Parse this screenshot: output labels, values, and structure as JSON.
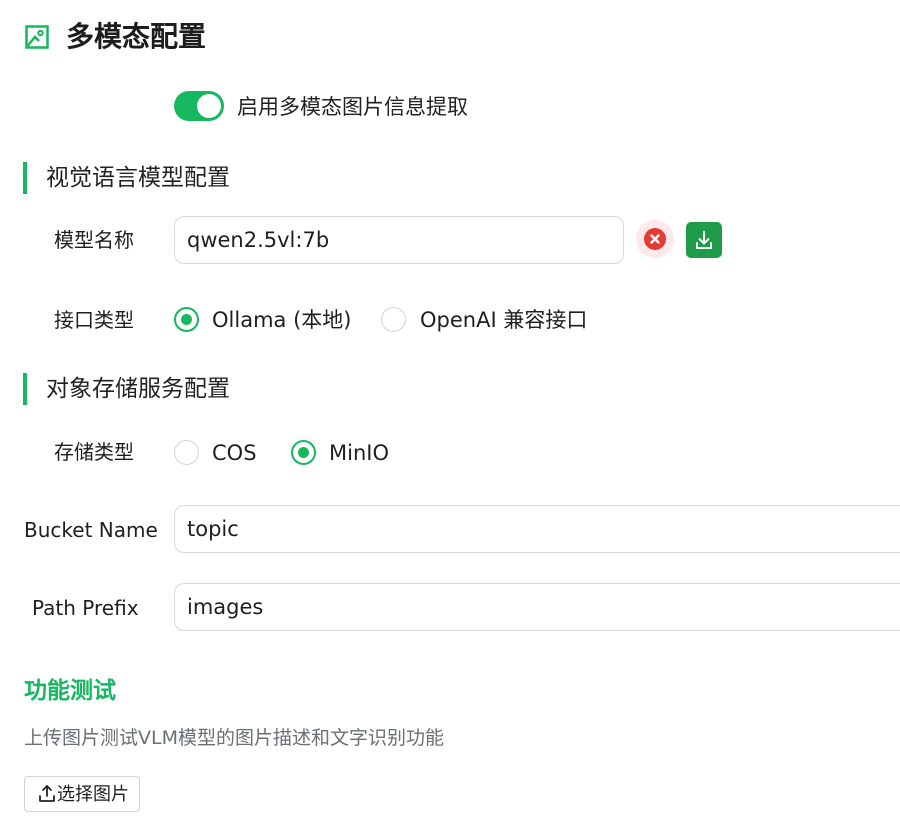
{
  "header": {
    "title": "多模态配置",
    "icon": "image-icon"
  },
  "multimodal_toggle": {
    "label": "启用多模态图片信息提取",
    "enabled": true
  },
  "vlm_section": {
    "title": "视觉语言模型配置",
    "model_name": {
      "label": "模型名称",
      "value": "qwen2.5vl:7b"
    },
    "interface_type": {
      "label": "接口类型",
      "options": [
        {
          "label": "Ollama (本地)",
          "checked": true
        },
        {
          "label": "OpenAI 兼容接口",
          "checked": false
        }
      ]
    }
  },
  "storage_section": {
    "title": "对象存储服务配置",
    "storage_type": {
      "label": "存储类型",
      "options": [
        {
          "label": "COS",
          "checked": false
        },
        {
          "label": "MinIO",
          "checked": true
        }
      ]
    },
    "bucket_name": {
      "label": "Bucket Name",
      "value": "topic"
    },
    "path_prefix": {
      "label": "Path Prefix",
      "value": "images"
    }
  },
  "function_test": {
    "title": "功能测试",
    "description": "上传图片测试VLM模型的图片描述和文字识别功能",
    "upload_button": "选择图片"
  },
  "colors": {
    "accent": "#15b85f",
    "danger": "#e53935",
    "download": "#1f9c4a",
    "muted_text": "#6b6f76"
  }
}
